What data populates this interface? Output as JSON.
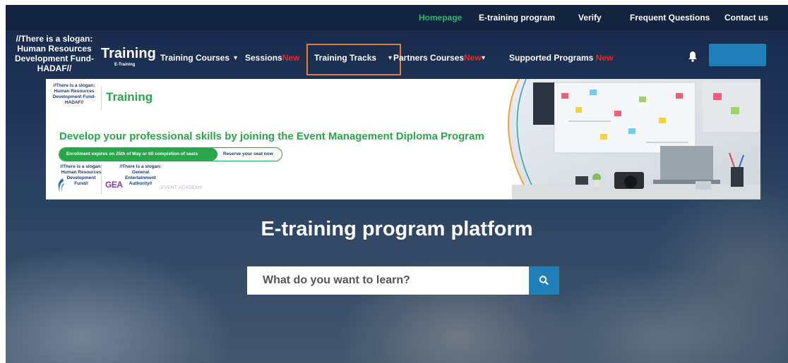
{
  "topbar": {
    "links": [
      "Homepage",
      "E-training program",
      "Verify",
      "Frequent Questions",
      "Contact us"
    ],
    "active": "Homepage",
    "active_color": "#2bb673"
  },
  "header": {
    "slogan": "//There is a slogan: Human Resources Development Fund- HADAF//",
    "brand": "Training",
    "brand_sub": "E-Training",
    "nav": {
      "training_courses": "Training Courses",
      "sessions": "Sessions",
      "sessions_badge": "New",
      "training_tracks": "Training Tracks",
      "partners_courses": "Partners Courses",
      "partners_badge": "New",
      "supported_programs": "Supported Programs",
      "supported_badge": "New"
    },
    "highlight_color": "#ee7b2b",
    "bell_icon": "bell-icon",
    "button_color": "#1f7fb8"
  },
  "banner": {
    "slogan": "//There is a slogan: Human Resources Development Fund- HADAF//",
    "brand": "Training",
    "headline": "Develop your professional skills by joining the Event Management Diploma Program",
    "enrollment": "Enrollment  expires on 25th of May or till completion of seats",
    "reserve": "Reserve your seat now",
    "hadaf_logo_text": "//There is a slogan: Human Resources Development Fund//",
    "gea_logo": "GEA",
    "gea_text": "//There is a slogan: General Entertainment Authority//",
    "event_academy": "EVENT ACADEMY",
    "accent_color": "#2aa54b"
  },
  "hero": {
    "title": "E-training program platform",
    "search_placeholder": "What do you want to learn?",
    "search_icon": "search-icon"
  }
}
